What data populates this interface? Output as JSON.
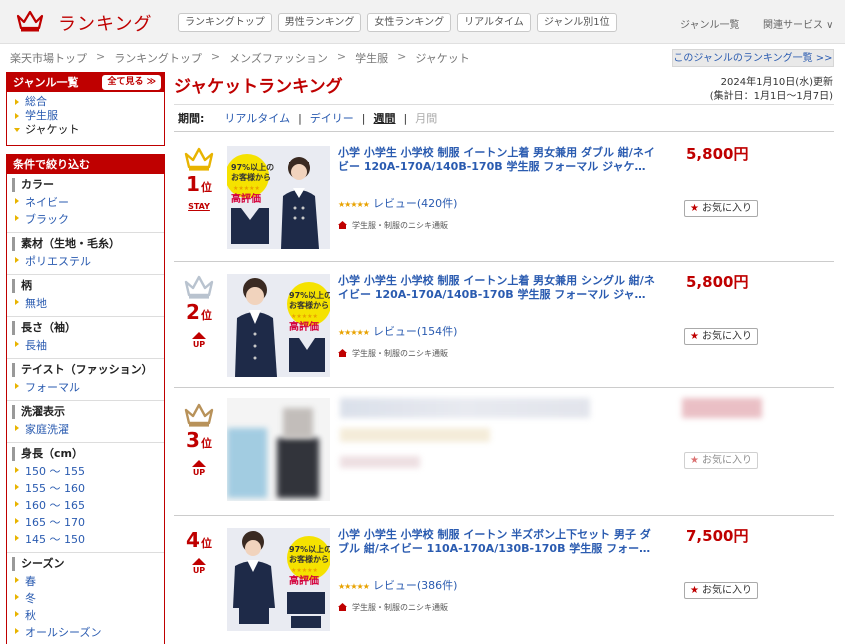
{
  "header": {
    "logo_text": "ランキング",
    "tabs": [
      "ランキングトップ",
      "男性ランキング",
      "女性ランキング",
      "リアルタイム",
      "ジャンル別1位"
    ],
    "genre_list": "ジャンル一覧",
    "related_services": "関連サービス ∨"
  },
  "breadcrumb": [
    "楽天市場トップ",
    "ランキングトップ",
    "メンズファッション",
    "学生服",
    "ジャケット"
  ],
  "breadcrumb_sep": ">",
  "genre_all_link": "このジャンルのランキング一覧 >>",
  "sidebar": {
    "genre_title": "ジャンル一覧",
    "see_all": "全て見る ≫",
    "genres": [
      "総合",
      "学生服",
      "ジャケット"
    ],
    "filter_title": "条件で絞り込む",
    "filters": [
      {
        "title": "カラー",
        "options": [
          "ネイビー",
          "ブラック"
        ]
      },
      {
        "title": "素材（生地・毛糸）",
        "options": [
          "ポリエステル"
        ]
      },
      {
        "title": "柄",
        "options": [
          "無地"
        ]
      },
      {
        "title": "長さ（袖）",
        "options": [
          "長袖"
        ]
      },
      {
        "title": "テイスト（ファッション）",
        "options": [
          "フォーマル"
        ]
      },
      {
        "title": "洗濯表示",
        "options": [
          "家庭洗濯"
        ]
      },
      {
        "title": "身長（cm）",
        "options": [
          "150 ～ 155",
          "155 ～ 160",
          "160 ～ 165",
          "165 ～ 170",
          "145 ～ 150"
        ]
      },
      {
        "title": "シーズン",
        "options": [
          "春",
          "冬",
          "秋",
          "オールシーズン"
        ]
      }
    ]
  },
  "main": {
    "title": "ジャケットランキング",
    "updated": "2024年1月10日(水)更新",
    "period_total": "(集計日：1月1日～1月7日)",
    "period_label": "期間:",
    "periods": [
      "リアルタイム",
      "デイリー",
      "週間",
      "月間"
    ],
    "period_sep": "|",
    "items": [
      {
        "rank": "1",
        "rank_suffix": "位",
        "move": "STAY",
        "title": "小学 小学生 小学校 制服 イートン上着 男女兼用 ダブル 紺/ネイビー 120A-170A/140B-170B 学生服 フォーマル ジャケ…",
        "price": "5,800円",
        "stars": "★★★★★",
        "review": "レビュー(420件)",
        "shop": "学生服・制服のニシキ通販",
        "fav": "お気に入り",
        "thumb_text": [
          "97%以上の",
          "お客様から",
          "★★★★★",
          "高評価"
        ]
      },
      {
        "rank": "2",
        "rank_suffix": "位",
        "move": "UP",
        "title": "小学 小学生 小学校 制服 イートン上着 男女兼用 シングル 紺/ネイビー 120A-170A/140B-170B 学生服 フォーマル ジャ…",
        "price": "5,800円",
        "stars": "★★★★★",
        "review": "レビュー(154件)",
        "shop": "学生服・制服のニシキ通販",
        "fav": "お気に入り",
        "thumb_text": [
          "97%以上の",
          "お客様から",
          "★★★★★",
          "高評価"
        ]
      },
      {
        "rank": "3",
        "rank_suffix": "位",
        "move": "UP",
        "fav": "お気に入り"
      },
      {
        "rank": "4",
        "rank_suffix": "位",
        "move": "UP",
        "title": "小学 小学生 小学校 制服 イートン 半ズボン上下セット 男子 ダブル 紺/ネイビー 110A-170A/130B-170B 学生服 フォー…",
        "price": "7,500円",
        "stars": "★★★★★",
        "review": "レビュー(386件)",
        "shop": "学生服・制服のニシキ通販",
        "fav": "お気に入り",
        "thumb_text": [
          "97%以上の",
          "お客様から",
          "★★★★★",
          "高評価"
        ]
      }
    ]
  },
  "colors": {
    "brand_red": "#bf0000",
    "link_blue": "#2a5bb0",
    "gold": "#e8b400",
    "silver": "#b9c3cf",
    "bronze": "#b8925a"
  }
}
